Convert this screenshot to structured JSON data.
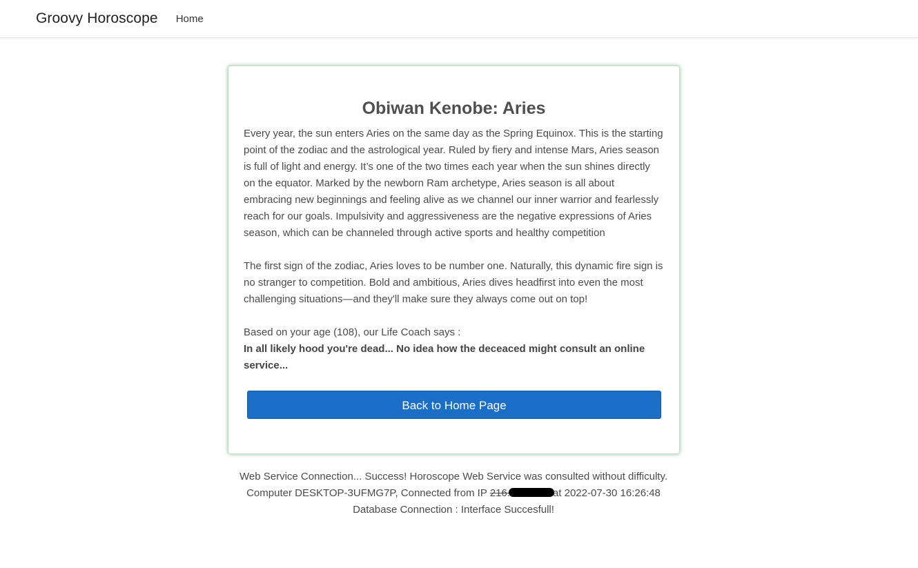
{
  "navbar": {
    "brand": "Groovy Horoscope",
    "home_link": "Home"
  },
  "card": {
    "title": "Obiwan Kenobe: Aries",
    "paragraph1": "Every year, the sun enters Aries on the same day as the Spring Equinox. This is the starting point of the zodiac and the astrological year. Ruled by fiery and intense Mars, Aries season is full of light and energy. It’s one of the two times each year when the sun shines directly on the equator. Marked by the newborn Ram archetype, Aries season is all about embracing new beginnings and feeling alive as we channel our inner warrior and fearlessly reach for our goals. Impulsivity and aggressiveness are the negative expressions of Aries season, which can be channeled through active sports and healthy competition",
    "paragraph2": "The first sign of the zodiac, Aries loves to be number one. Naturally, this dynamic fire sign is no stranger to competition. Bold and ambitious, Aries dives headfirst into even the most challenging situations—and they'll make sure they always come out on top!",
    "coach_intro": "Based on your age (108), our Life Coach says :",
    "coach_advice": "In all likely hood you're dead... No idea how the deceaced might consult an online service...",
    "button_label": "Back to Home Page"
  },
  "footer": {
    "line1": "Web Service Connection... Success! Horoscope Web Service was consulted without difficulty.",
    "line2_prefix": "Computer DESKTOP-3UFMG7P, Connected from IP ",
    "line2_ip_visible": "216.",
    "line2_suffix": "at 2022-07-30 16:26:48",
    "line3": "Database Connection : Interface Succesfull!"
  },
  "colors": {
    "button_bg": "#1a6ec6",
    "card_glow": "#3c8c50"
  }
}
